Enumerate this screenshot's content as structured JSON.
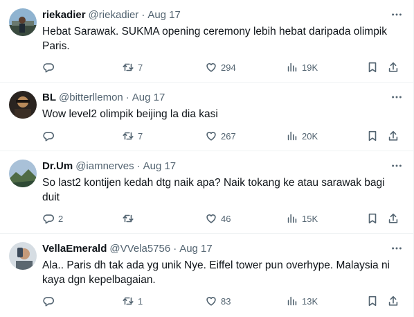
{
  "tweets": [
    {
      "name": "riekadier",
      "handle": "@riekadier",
      "separator": "·",
      "date": "Aug 17",
      "text": "Hebat Sarawak. SUKMA opening ceremony lebih hebat daripada olimpik Paris.",
      "replies": "",
      "retweets": "7",
      "likes": "294",
      "views": "19K",
      "avatar_colors": [
        "#7fa7c9",
        "#3a4a3e"
      ]
    },
    {
      "name": "BL",
      "handle": "@bitterllemon",
      "separator": "·",
      "date": "Aug 17",
      "text": "Wow level2 olimpik beijing la dia kasi",
      "replies": "",
      "retweets": "7",
      "likes": "267",
      "views": "20K",
      "avatar_colors": [
        "#2a2420",
        "#b98a5a"
      ]
    },
    {
      "name": "Dr.Um",
      "handle": "@iamnerves",
      "separator": "·",
      "date": "Aug 17",
      "text": "So last2 kontijen kedah dtg naik apa? Naik tokang ke atau sarawak bagi duit",
      "replies": "2",
      "retweets": "",
      "likes": "46",
      "views": "15K",
      "avatar_colors": [
        "#9bb5cf",
        "#4f6b45"
      ]
    },
    {
      "name": "VellaEmerald",
      "handle": "@VVela5756",
      "separator": "·",
      "date": "Aug 17",
      "text": "Ala.. Paris dh tak ada yg unik Nye. Eiffel tower pun overhype. Malaysia ni kaya dgn kepelbagaian.",
      "replies": "",
      "retweets": "1",
      "likes": "83",
      "views": "13K",
      "avatar_colors": [
        "#cfd6dd",
        "#3c4a5a"
      ]
    }
  ],
  "icons": {
    "more": "more-icon",
    "reply": "reply-icon",
    "retweet": "retweet-icon",
    "like": "like-icon",
    "views": "views-icon",
    "bookmark": "bookmark-icon",
    "share": "share-icon"
  },
  "colors": {
    "text": "#0f1419",
    "secondary": "#536471",
    "divider": "#eff3f4"
  }
}
